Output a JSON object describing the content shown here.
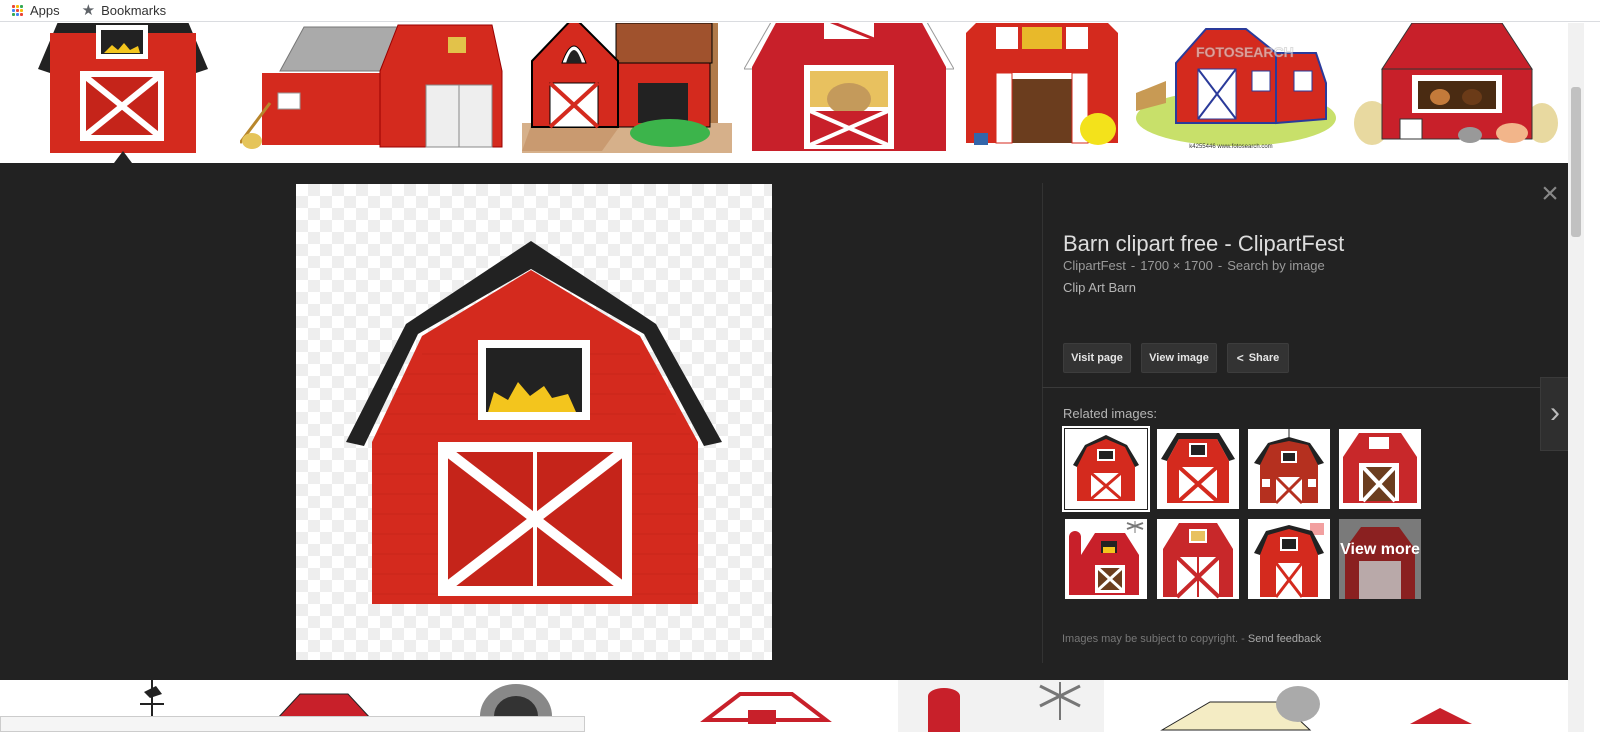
{
  "bookmarks_bar": {
    "apps_label": "Apps",
    "bookmarks_label": "Bookmarks"
  },
  "detail": {
    "title": "Barn clipart free - ClipartFest",
    "source": "ClipartFest",
    "dimensions": "1700 × 1700",
    "search_by_image": "Search by image",
    "subtitle": "Clip Art Barn",
    "buttons": {
      "visit_page": "Visit page",
      "view_image": "View image",
      "share": "Share"
    },
    "related_label": "Related images:",
    "view_more": "View more",
    "copyright": "Images may be subject to copyright.",
    "send_feedback": "Send feedback",
    "close_icon": "close-icon",
    "next_icon": "chevron-right-icon"
  },
  "thumbnail_watermarks": {
    "fotosearch": "FOTOSEARCH",
    "fotosearch_caption": "k4255446 www.fotosearch.com"
  },
  "colors": {
    "barn_red": "#d42a1e",
    "panel_bg": "#222222",
    "roof_dark": "#222222"
  }
}
